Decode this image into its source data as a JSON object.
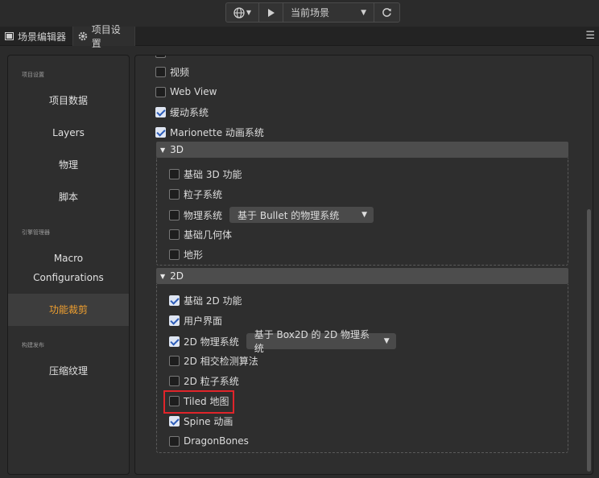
{
  "toolbar": {
    "scene_select": "当前场景"
  },
  "tabs": {
    "scene_editor": "场景编辑器",
    "project_settings": "项目设置"
  },
  "sidebar": {
    "section_project": "项目设置",
    "project_data": "项目数据",
    "layers": "Layers",
    "physics": "物理",
    "scripts": "脚本",
    "section_engine": "引擎管理器",
    "macro_line1": "Macro",
    "macro_line2": "Configurations",
    "feature_cropping": "功能裁剪",
    "section_build": "构建发布",
    "texture_compression": "压缩纹理"
  },
  "features": {
    "video": {
      "label": "视频",
      "checked": false
    },
    "webview": {
      "label": "Web View",
      "checked": false
    },
    "tween": {
      "label": "缓动系统",
      "checked": true
    },
    "marionette": {
      "label": "Marionette 动画系统",
      "checked": true
    }
  },
  "group3d": {
    "title": "3D",
    "base3d": {
      "label": "基础 3D 功能",
      "checked": false
    },
    "particle": {
      "label": "粒子系统",
      "checked": false
    },
    "physics": {
      "label": "物理系统",
      "checked": false,
      "dropdown": "基于 Bullet 的物理系统"
    },
    "geometry": {
      "label": "基础几何体",
      "checked": false
    },
    "terrain": {
      "label": "地形",
      "checked": false
    }
  },
  "group2d": {
    "title": "2D",
    "base2d": {
      "label": "基础 2D 功能",
      "checked": true
    },
    "ui": {
      "label": "用户界面",
      "checked": true
    },
    "physics2d": {
      "label": "2D 物理系统",
      "checked": true,
      "dropdown": "基于 Box2D 的 2D 物理系统"
    },
    "intersection": {
      "label": "2D 相交检测算法",
      "checked": false
    },
    "particle2d": {
      "label": "2D 粒子系统",
      "checked": false
    },
    "tiled": {
      "label": "Tiled 地图",
      "checked": false
    },
    "spine": {
      "label": "Spine 动画",
      "checked": true
    },
    "dragonbones": {
      "label": "DragonBones",
      "checked": false
    }
  },
  "colors": {
    "accent_active": "#f0a030",
    "highlight_box": "#e0242a",
    "checkbox_checked": "#dfe6f3"
  }
}
